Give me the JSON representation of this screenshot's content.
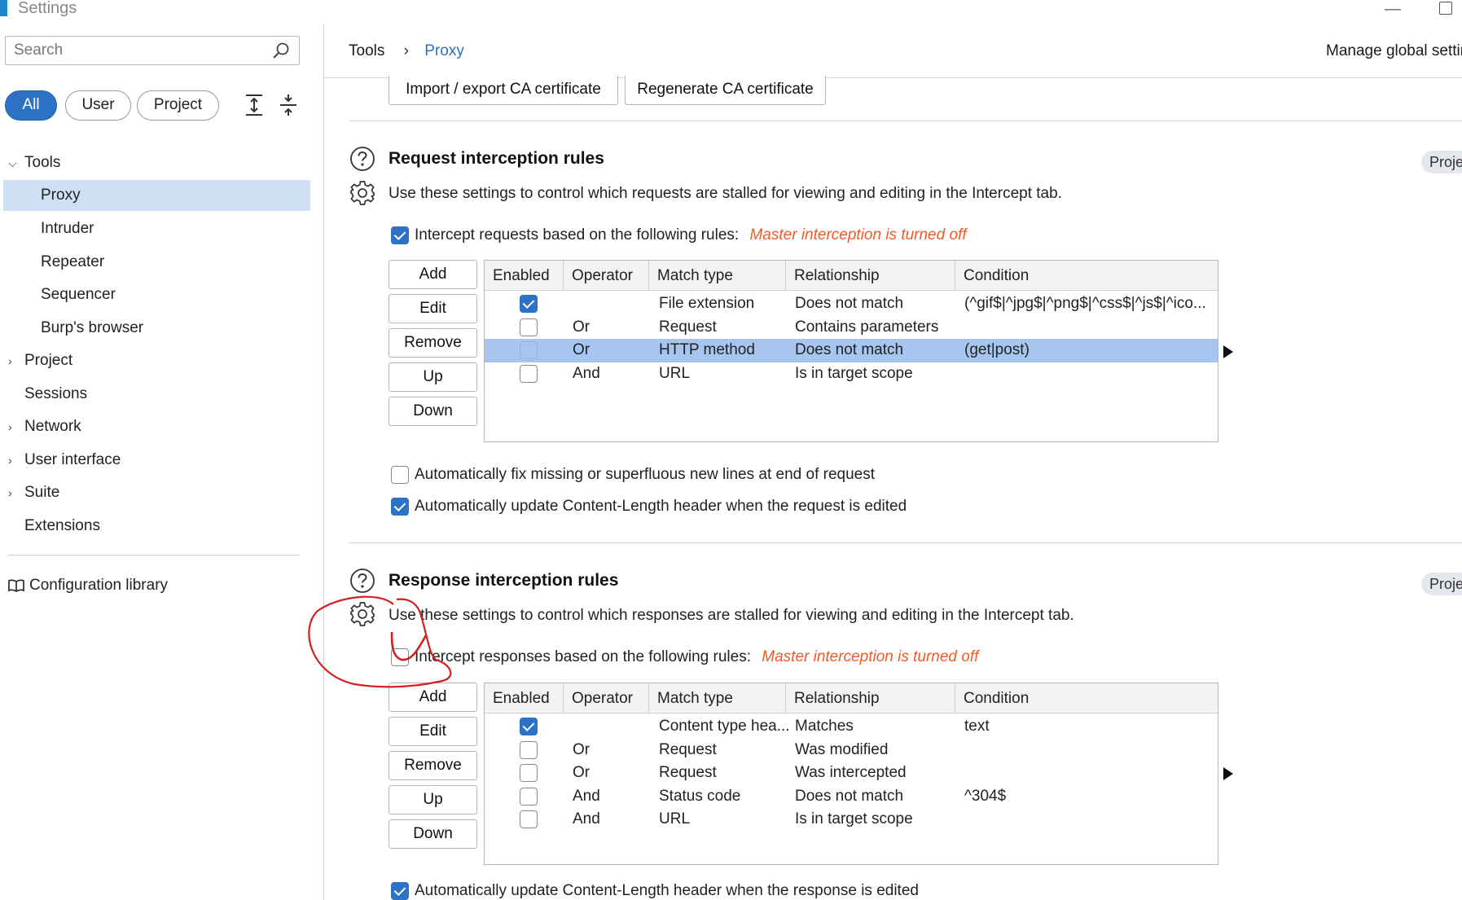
{
  "window": {
    "title": "Settings",
    "minimize_glyph": "—"
  },
  "sidebar": {
    "search_placeholder": "Search",
    "filters": [
      "All",
      "User",
      "Project"
    ],
    "active_filter": "All",
    "tree": {
      "tools": "Tools",
      "proxy": "Proxy",
      "intruder": "Intruder",
      "repeater": "Repeater",
      "sequencer": "Sequencer",
      "burps_browser": "Burp's browser",
      "project": "Project",
      "sessions": "Sessions",
      "network": "Network",
      "user_interface": "User interface",
      "suite": "Suite",
      "extensions": "Extensions"
    },
    "config_library": "Configuration library"
  },
  "header": {
    "breadcrumb": [
      "Tools",
      "Proxy"
    ],
    "breadcrumb_sep": "›",
    "global_link": "Manage global settir"
  },
  "ca_buttons": [
    "Import / export CA certificate",
    "Regenerate CA certificate"
  ],
  "request_section": {
    "title": "Request interception rules",
    "description": "Use these settings to control which requests are stalled for viewing and editing in the Intercept tab.",
    "badge": "Proje",
    "intercept_label": "Intercept requests based on the following rules:",
    "intercept_checked": true,
    "warning": "Master interception is turned off",
    "buttons": [
      "Add",
      "Edit",
      "Remove",
      "Up",
      "Down"
    ],
    "columns": [
      "Enabled",
      "Operator",
      "Match type",
      "Relationship",
      "Condition"
    ],
    "rows": [
      {
        "enabled": true,
        "operator": "",
        "match_type": "File extension",
        "relationship": "Does not match",
        "condition": "(^gif$|^jpg$|^png$|^css$|^js$|^ico...",
        "selected": false
      },
      {
        "enabled": false,
        "operator": "Or",
        "match_type": "Request",
        "relationship": "Contains parameters",
        "condition": "",
        "selected": false
      },
      {
        "enabled": false,
        "operator": "Or",
        "match_type": "HTTP method",
        "relationship": "Does not match",
        "condition": "(get|post)",
        "selected": true
      },
      {
        "enabled": false,
        "operator": "And",
        "match_type": "URL",
        "relationship": "Is in target scope",
        "condition": "",
        "selected": false
      }
    ],
    "option_fix_newlines": "Automatically fix missing or superfluous new lines at end of request",
    "option_fix_newlines_checked": false,
    "option_update_length": "Automatically update Content-Length header when the request is edited",
    "option_update_length_checked": true
  },
  "response_section": {
    "title": "Response interception rules",
    "description": "Use these settings to control which responses are stalled for viewing and editing in the Intercept tab.",
    "badge": "Proje",
    "intercept_label": "Intercept responses based on the following rules:",
    "intercept_checked": false,
    "warning": "Master interception is turned off",
    "buttons": [
      "Add",
      "Edit",
      "Remove",
      "Up",
      "Down"
    ],
    "columns": [
      "Enabled",
      "Operator",
      "Match type",
      "Relationship",
      "Condition"
    ],
    "rows": [
      {
        "enabled": true,
        "operator": "",
        "match_type": "Content type hea...",
        "relationship": "Matches",
        "condition": "text"
      },
      {
        "enabled": false,
        "operator": "Or",
        "match_type": "Request",
        "relationship": "Was modified",
        "condition": ""
      },
      {
        "enabled": false,
        "operator": "Or",
        "match_type": "Request",
        "relationship": "Was intercepted",
        "condition": ""
      },
      {
        "enabled": false,
        "operator": "And",
        "match_type": "Status code",
        "relationship": "Does not match",
        "condition": "^304$"
      },
      {
        "enabled": false,
        "operator": "And",
        "match_type": "URL",
        "relationship": "Is in target scope",
        "condition": ""
      }
    ],
    "option_update_length": "Automatically update Content-Length header when the response is edited",
    "option_update_length_checked": true
  },
  "colors": {
    "accent": "#2d72c4",
    "warning": "#f05a28",
    "selection": "#a7c6ef",
    "sidebar_selection": "#cfe0f4",
    "annotation": "#d21f1f"
  }
}
